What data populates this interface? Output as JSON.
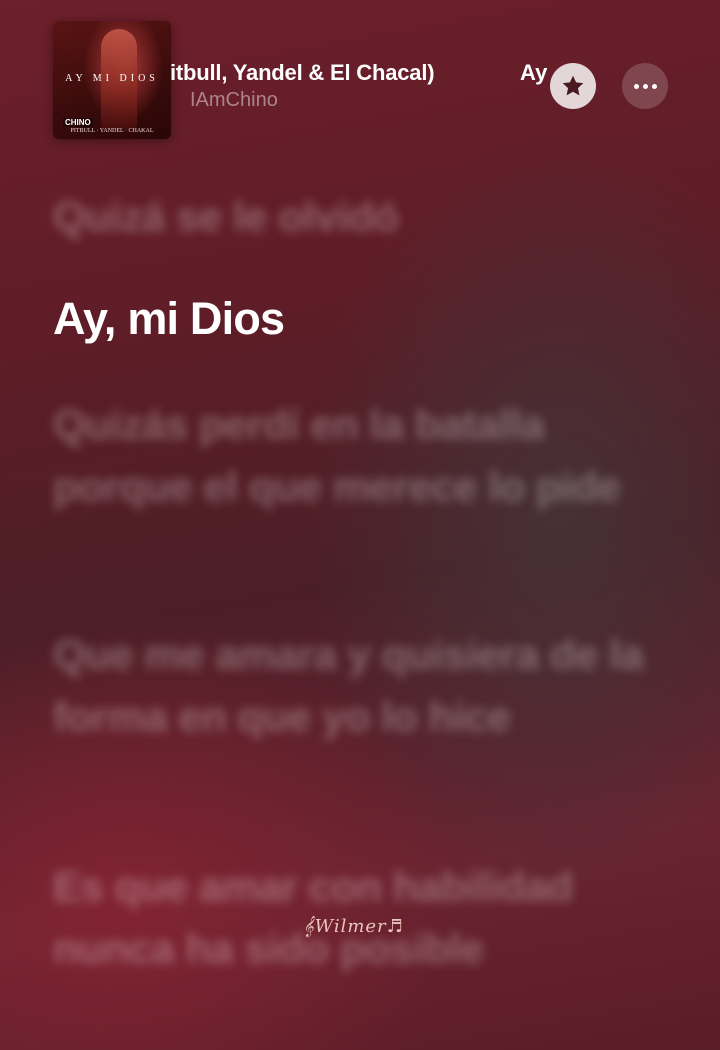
{
  "header": {
    "song_title": "itbull, Yandel & El Chacal)",
    "song_title_next": "Ay",
    "artist": "IAmChino"
  },
  "album_art": {
    "title": "AY MI DIOS",
    "logo": "CHINO",
    "credits": "PITBULL · YANDEL · CHAKAL"
  },
  "buttons": {
    "favorite_icon": "star-icon",
    "more_icon": "ellipsis-icon"
  },
  "lyrics": {
    "previous": "Quizá se le olvidó",
    "current": "Ay, mi Dios",
    "upcoming": [
      "Quizás perdí en la batalla porque el que merece lo pide",
      "Que me amara y quisiera de la forma en que yo lo hice",
      "Es que amar con habilidad nunca ha sido posible"
    ]
  },
  "watermark": "𝄞Wilmer♬",
  "colors": {
    "background": "#5e1d27",
    "active_lyric": "#ffffff",
    "inactive_lyric": "rgba(255,255,255,0.30)"
  }
}
